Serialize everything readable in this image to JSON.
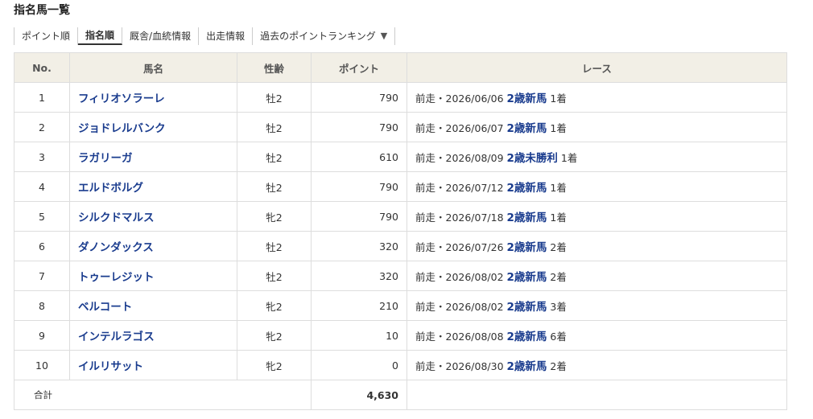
{
  "page": {
    "title": "指名馬一覧"
  },
  "tabs": [
    {
      "label": "ポイント順",
      "active": false
    },
    {
      "label": "指名順",
      "active": true
    },
    {
      "label": "厩舎/血統情報",
      "active": false
    },
    {
      "label": "出走情報",
      "active": false
    },
    {
      "label": "過去のポイントランキング",
      "active": false,
      "dropdown_icon": "caret-down-icon"
    }
  ],
  "table": {
    "headers": {
      "no": "No.",
      "name": "馬名",
      "sex_age": "性齢",
      "points": "ポイント",
      "race": "レース"
    },
    "rows": [
      {
        "no": "1",
        "name": "フィリオソラーレ",
        "sex_age": "牡2",
        "points": "790",
        "race_prefix": "前走・2026/06/06",
        "race_name": "2歳新馬",
        "finish": "1着"
      },
      {
        "no": "2",
        "name": "ジョドレルバンク",
        "sex_age": "牡2",
        "points": "790",
        "race_prefix": "前走・2026/06/07",
        "race_name": "2歳新馬",
        "finish": "1着"
      },
      {
        "no": "3",
        "name": "ラガリーガ",
        "sex_age": "牡2",
        "points": "610",
        "race_prefix": "前走・2026/08/09",
        "race_name": "2歳未勝利",
        "finish": "1着"
      },
      {
        "no": "4",
        "name": "エルドボルグ",
        "sex_age": "牡2",
        "points": "790",
        "race_prefix": "前走・2026/07/12",
        "race_name": "2歳新馬",
        "finish": "1着"
      },
      {
        "no": "5",
        "name": "シルクドマルス",
        "sex_age": "牝2",
        "points": "790",
        "race_prefix": "前走・2026/07/18",
        "race_name": "2歳新馬",
        "finish": "1着"
      },
      {
        "no": "6",
        "name": "ダノンダックス",
        "sex_age": "牡2",
        "points": "320",
        "race_prefix": "前走・2026/07/26",
        "race_name": "2歳新馬",
        "finish": "2着"
      },
      {
        "no": "7",
        "name": "トゥーレジット",
        "sex_age": "牡2",
        "points": "320",
        "race_prefix": "前走・2026/08/02",
        "race_name": "2歳新馬",
        "finish": "2着"
      },
      {
        "no": "8",
        "name": "ベルコート",
        "sex_age": "牝2",
        "points": "210",
        "race_prefix": "前走・2026/08/02",
        "race_name": "2歳新馬",
        "finish": "3着"
      },
      {
        "no": "9",
        "name": "インテルラゴス",
        "sex_age": "牝2",
        "points": "10",
        "race_prefix": "前走・2026/08/08",
        "race_name": "2歳新馬",
        "finish": "6着"
      },
      {
        "no": "10",
        "name": "イルリサット",
        "sex_age": "牝2",
        "points": "0",
        "race_prefix": "前走・2026/08/30",
        "race_name": "2歳新馬",
        "finish": "2着"
      }
    ],
    "footer": {
      "label": "合計",
      "total_points": "4,630"
    }
  },
  "colors": {
    "link": "#1a3c8e",
    "header_bg": "#f2efe6",
    "border": "#dddddd"
  }
}
